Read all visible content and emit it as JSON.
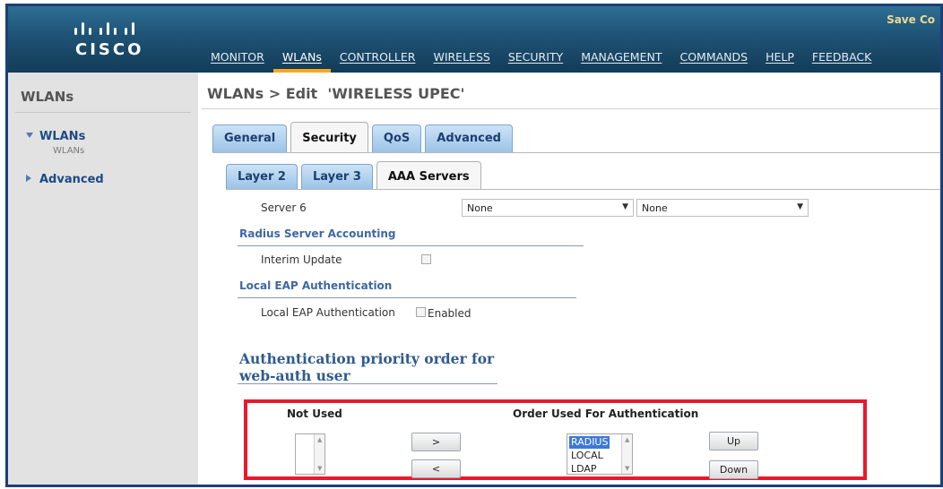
{
  "header": {
    "logo_text": "CISCO",
    "save_link": "Save Co",
    "menu": [
      "MONITOR",
      "WLANs",
      "CONTROLLER",
      "WIRELESS",
      "SECURITY",
      "MANAGEMENT",
      "COMMANDS",
      "HELP",
      "FEEDBACK"
    ],
    "active_menu": "WLANs"
  },
  "sidebar": {
    "title": "WLANs",
    "items": [
      {
        "label": "WLANs",
        "expanded": true,
        "sub": "WLANs"
      },
      {
        "label": "Advanced",
        "expanded": false
      }
    ]
  },
  "main": {
    "page_title": "WLANs > Edit  'WIRELESS UPEC'",
    "tabs": [
      "General",
      "Security",
      "QoS",
      "Advanced"
    ],
    "active_tab": "Security",
    "subtabs": [
      "Layer 2",
      "Layer 3",
      "AAA Servers"
    ],
    "active_subtab": "AAA Servers",
    "server6": {
      "label": "Server 6",
      "value1": "None",
      "value2": "None"
    },
    "radius_accounting": {
      "heading": "Radius Server Accounting",
      "interim_label": "Interim Update"
    },
    "local_eap": {
      "heading": "Local EAP Authentication",
      "label": "Local EAP Authentication",
      "checkbox_label": "Enabled"
    },
    "priority": {
      "heading_line1": "Authentication priority order for",
      "heading_line2": "web-auth user",
      "not_used_label": "Not Used",
      "order_label": "Order Used For Authentication",
      "move_right": ">",
      "move_left": "<",
      "order_items": [
        "RADIUS",
        "LOCAL",
        "LDAP"
      ],
      "selected_item": "RADIUS",
      "up_label": "Up",
      "down_label": "Down"
    }
  },
  "colors": {
    "header": "#1e5274",
    "active_menu_underline": "#f7a91d",
    "highlight_box": "#e8192c",
    "section_heading": "#3e68a3"
  }
}
